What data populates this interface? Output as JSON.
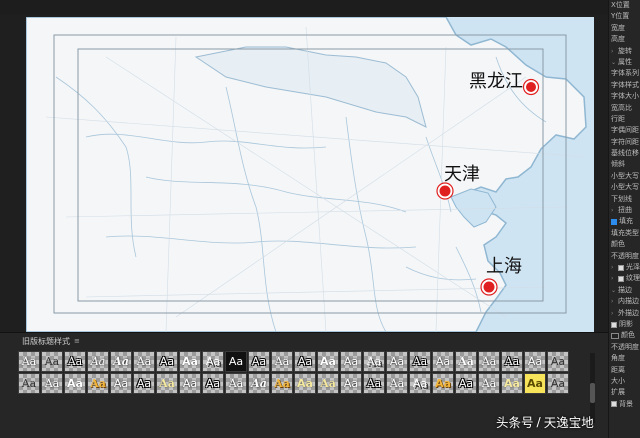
{
  "map": {
    "cities": [
      {
        "name": "黑龙江",
        "label": "黑龙江"
      },
      {
        "name": "天津",
        "label": "天津"
      },
      {
        "name": "上海",
        "label": "上海"
      }
    ],
    "colors": {
      "land": "#f3f5f7",
      "water": "#cfe4f2",
      "border": "#8fb7d2",
      "marker": "#e02020",
      "marker_ring": "#ffffff"
    }
  },
  "properties_panel": {
    "rows": [
      {
        "label": "X位置"
      },
      {
        "label": "Y位置"
      },
      {
        "label": "宽度"
      },
      {
        "label": "高度"
      },
      {
        "label": "旋转"
      },
      {
        "label": "属性"
      },
      {
        "label": "字体系列"
      },
      {
        "label": "字体样式"
      },
      {
        "label": "字体大小"
      },
      {
        "label": "宽高比"
      },
      {
        "label": "行距"
      },
      {
        "label": "字偶间距"
      },
      {
        "label": "字符间距"
      },
      {
        "label": "基线位移"
      },
      {
        "label": "倾斜"
      },
      {
        "label": "小型大写"
      },
      {
        "label": "小型大写"
      },
      {
        "label": "下划线"
      },
      {
        "label": "扭曲"
      },
      {
        "label": "填充",
        "checked": true
      },
      {
        "label": "填充类型"
      },
      {
        "label": "颜色"
      },
      {
        "label": "不透明度"
      },
      {
        "label": "光泽"
      },
      {
        "label": "纹理"
      },
      {
        "label": "描边"
      },
      {
        "label": "内描边"
      },
      {
        "label": "外描边"
      },
      {
        "label": "阴影"
      },
      {
        "label": "颜色"
      },
      {
        "label": "不透明度"
      },
      {
        "label": "角度"
      },
      {
        "label": "距离"
      },
      {
        "label": "大小"
      },
      {
        "label": "扩展"
      },
      {
        "label": "背景"
      }
    ]
  },
  "styles_panel": {
    "title": "旧版标题样式",
    "menu_icon": "menu-icon",
    "tile_text": "Aa"
  },
  "watermark": {
    "prefix": "头条号",
    "separator": "/",
    "name": "天逸宝地"
  }
}
